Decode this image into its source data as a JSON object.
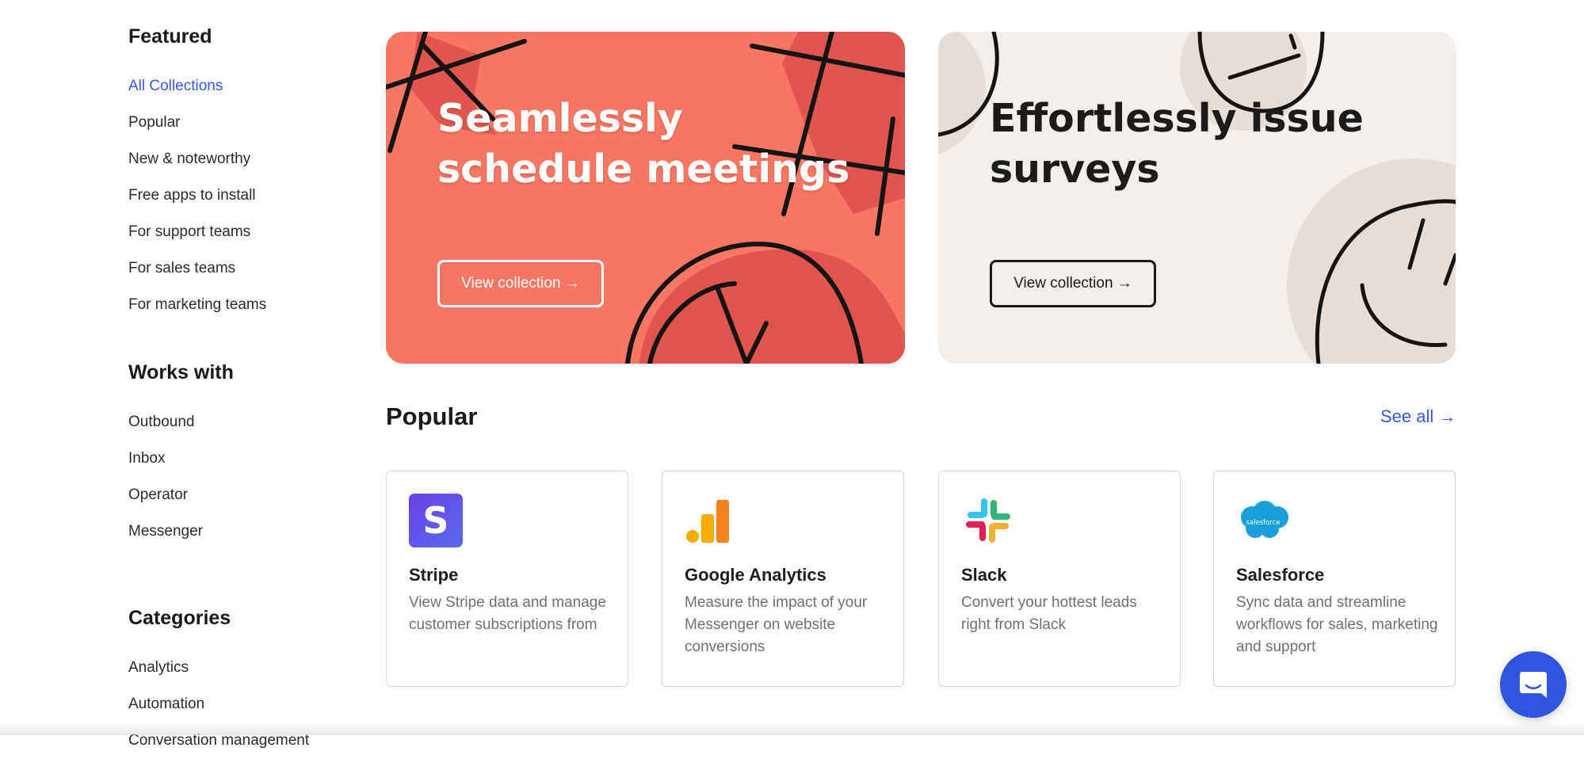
{
  "sidebar": {
    "featured": {
      "heading": "Featured",
      "items": [
        "All Collections",
        "Popular",
        "New & noteworthy",
        "Free apps to install",
        "For support teams",
        "For sales teams",
        "For marketing teams"
      ]
    },
    "works_with": {
      "heading": "Works with",
      "items": [
        "Outbound",
        "Inbox",
        "Operator",
        "Messenger"
      ]
    },
    "categories": {
      "heading": "Categories",
      "items": [
        "Analytics",
        "Automation",
        "Conversation management"
      ]
    }
  },
  "banners": [
    {
      "title": "Seamlessly schedule meetings",
      "button": "View collection →",
      "bg": "#f87762"
    },
    {
      "title": "Effortlessly issue surveys",
      "button": "View collection →",
      "bg": "#f3eeea"
    }
  ],
  "popular": {
    "title": "Popular",
    "see_all": "See all →",
    "cards": [
      {
        "name": "Stripe",
        "description": "View Stripe data and manage customer subscriptions from",
        "icon": "stripe-logo-icon"
      },
      {
        "name": "Google Analytics",
        "description": "Measure the impact of your Messenger on website conversions",
        "icon": "google-analytics-logo-icon"
      },
      {
        "name": "Slack",
        "description": "Convert your hottest leads right from Slack",
        "icon": "slack-logo-icon"
      },
      {
        "name": "Salesforce",
        "description": "Sync data and streamline workflows for sales, marketing and support",
        "icon": "salesforce-logo-icon",
        "logo_text": "salesforce"
      }
    ]
  },
  "colors": {
    "accent": "#3756e6",
    "messenger": "#2f55df"
  }
}
